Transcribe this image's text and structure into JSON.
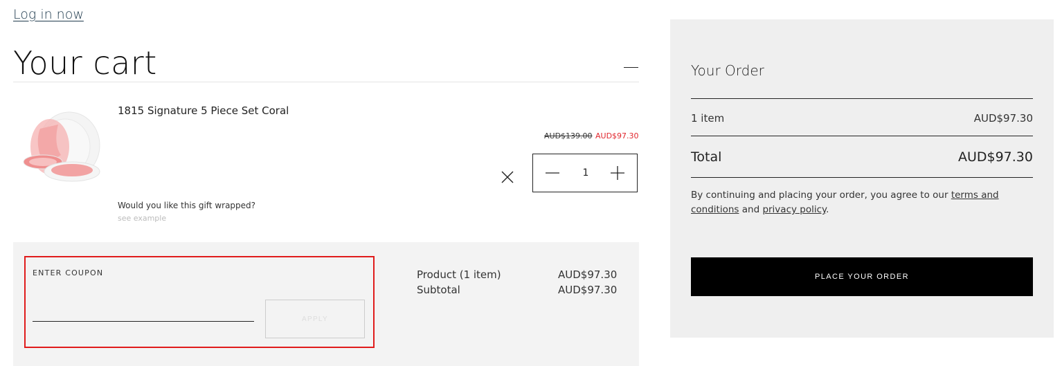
{
  "header": {
    "login_link": "Log in now"
  },
  "cart": {
    "title": "Your cart",
    "item": {
      "name": "1815 Signature 5 Piece Set Coral",
      "price_original": "AUD$139.00",
      "price_sale": "AUD$97.30",
      "quantity": "1",
      "gift_question": "Would you like this gift wrapped?",
      "gift_example_link": "see example"
    },
    "coupon": {
      "label": "ENTER COUPON",
      "input_value": "",
      "apply_label": "APPLY"
    },
    "summary": {
      "product_label": "Product (1 item)",
      "product_value": "AUD$97.30",
      "subtotal_label": "Subtotal",
      "subtotal_value": "AUD$97.30"
    }
  },
  "order": {
    "title": "Your Order",
    "items_label": "1 item",
    "items_value": "AUD$97.30",
    "total_label": "Total",
    "total_value": "AUD$97.30",
    "agreement_prefix": "By continuing and placing your order, you agree to our ",
    "terms_link": "terms and conditions",
    "agreement_and": " and ",
    "privacy_link": "privacy policy",
    "agreement_suffix": ".",
    "place_order_label": "PLACE YOUR ORDER"
  },
  "colors": {
    "sale_red": "#e1262d",
    "highlight_red": "#e01b1b",
    "panel_gray": "#efefef",
    "button_black": "#000000"
  }
}
